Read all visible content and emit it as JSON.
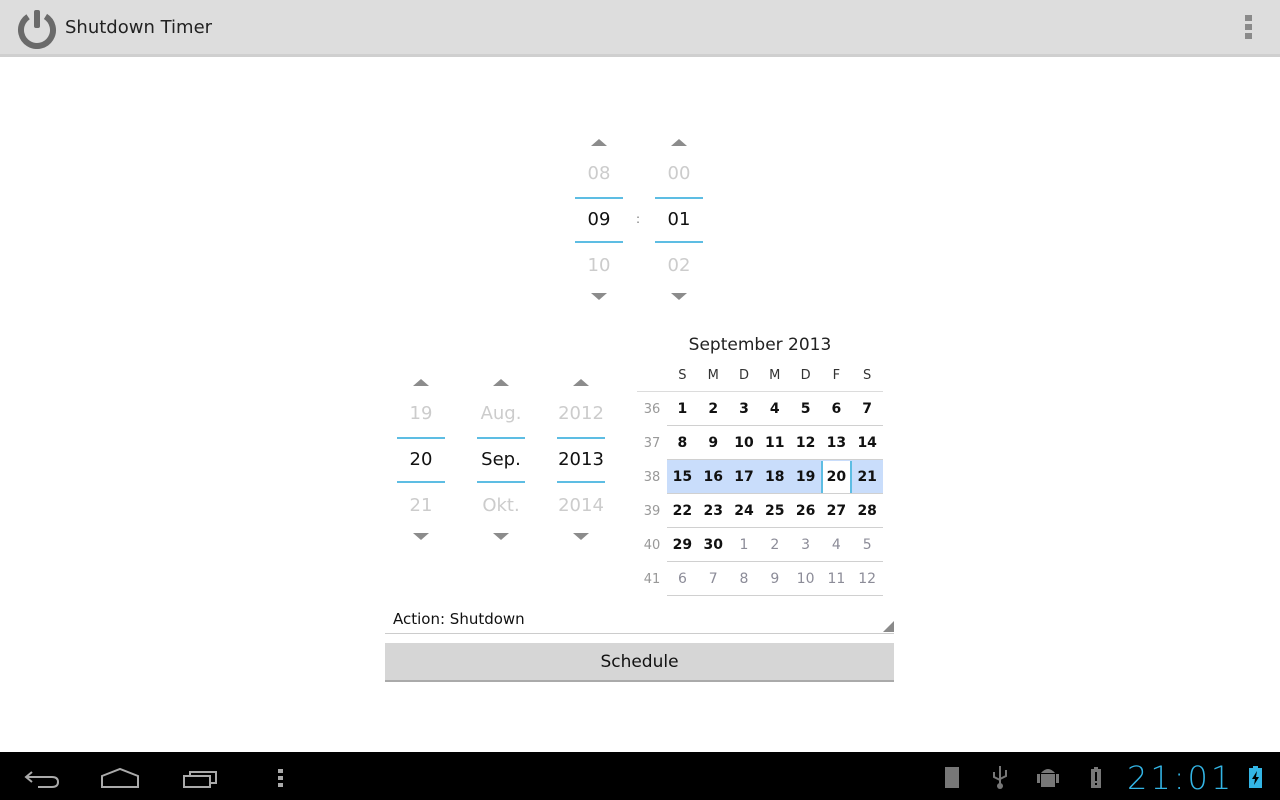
{
  "actionbar": {
    "title": "Shutdown Timer",
    "app_icon": "power-icon",
    "overflow_icon": "overflow-menu-icon"
  },
  "time_picker": {
    "hour": {
      "prev": "08",
      "current": "09",
      "next": "10"
    },
    "separator": ":",
    "minute": {
      "prev": "00",
      "current": "01",
      "next": "02"
    }
  },
  "date_picker": {
    "day": {
      "prev": "19",
      "current": "20",
      "next": "21"
    },
    "month": {
      "prev": "Aug.",
      "current": "Sep.",
      "next": "Okt."
    },
    "year": {
      "prev": "2012",
      "current": "2013",
      "next": "2014"
    }
  },
  "calendar": {
    "title": "September 2013",
    "weekdays": [
      "S",
      "M",
      "D",
      "M",
      "D",
      "F",
      "S"
    ],
    "selected_day": "20",
    "selected_week": "38",
    "weeks": [
      {
        "week": "36",
        "days": [
          "1",
          "2",
          "3",
          "4",
          "5",
          "6",
          "7"
        ],
        "other_month": [
          false,
          false,
          false,
          false,
          false,
          false,
          false
        ]
      },
      {
        "week": "37",
        "days": [
          "8",
          "9",
          "10",
          "11",
          "12",
          "13",
          "14"
        ],
        "other_month": [
          false,
          false,
          false,
          false,
          false,
          false,
          false
        ]
      },
      {
        "week": "38",
        "days": [
          "15",
          "16",
          "17",
          "18",
          "19",
          "20",
          "21"
        ],
        "other_month": [
          false,
          false,
          false,
          false,
          false,
          false,
          false
        ]
      },
      {
        "week": "39",
        "days": [
          "22",
          "23",
          "24",
          "25",
          "26",
          "27",
          "28"
        ],
        "other_month": [
          false,
          false,
          false,
          false,
          false,
          false,
          false
        ]
      },
      {
        "week": "40",
        "days": [
          "29",
          "30",
          "1",
          "2",
          "3",
          "4",
          "5"
        ],
        "other_month": [
          false,
          false,
          true,
          true,
          true,
          true,
          true
        ]
      },
      {
        "week": "41",
        "days": [
          "6",
          "7",
          "8",
          "9",
          "10",
          "11",
          "12"
        ],
        "other_month": [
          true,
          true,
          true,
          true,
          true,
          true,
          true
        ]
      }
    ]
  },
  "action_spinner": {
    "label": "Action: Shutdown"
  },
  "schedule_button": {
    "label": "Schedule"
  },
  "system_bar": {
    "clock": "21:01",
    "nav_icons": [
      "back-icon",
      "home-icon",
      "recent-apps-icon",
      "menu-icon"
    ],
    "status_icons": [
      "sd-card-icon",
      "usb-icon",
      "android-debug-icon",
      "battery-alert-icon",
      "battery-charging-icon"
    ],
    "accent_color": "#33b5e5"
  },
  "colors": {
    "picker_divider": "#5dbde3",
    "selected_week_bg": "#c9ddfb"
  }
}
